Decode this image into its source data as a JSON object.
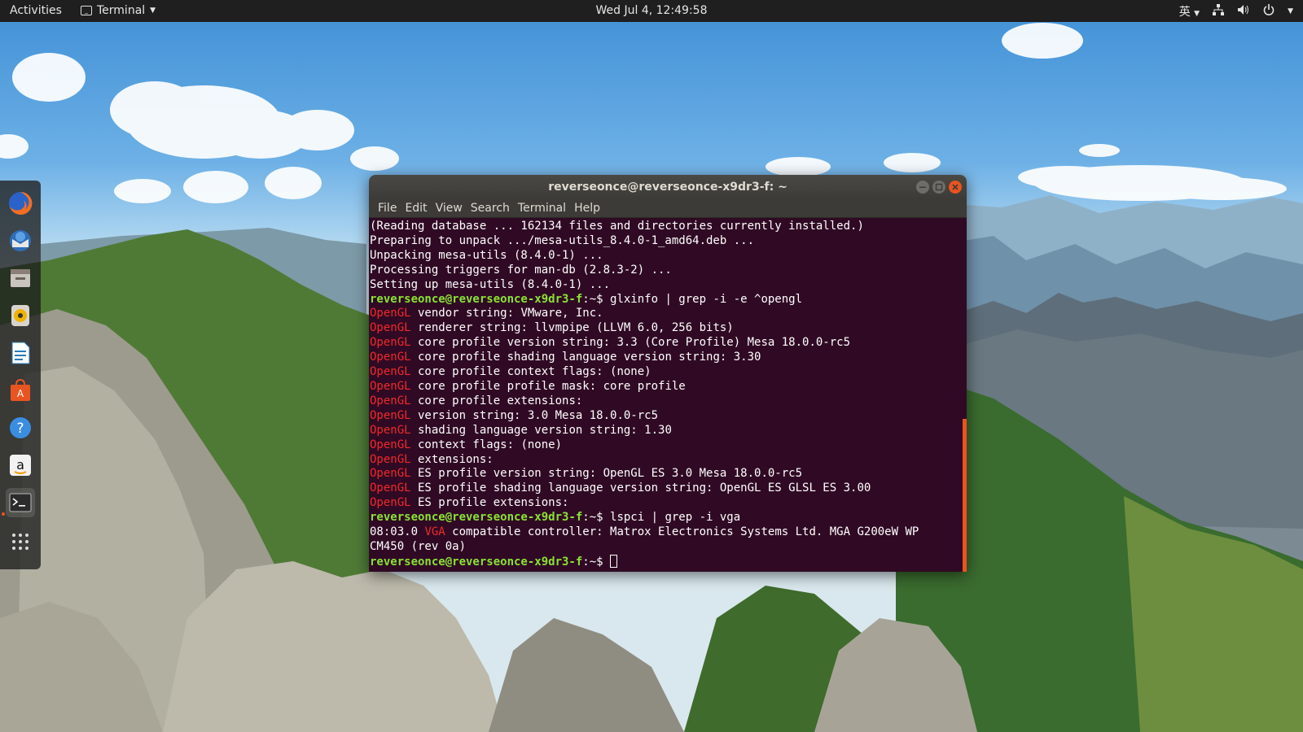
{
  "topbar": {
    "activities": "Activities",
    "app_name": "Terminal",
    "clock": "Wed Jul  4, 12:49:58",
    "input_method": "英",
    "icons": [
      "network-icon",
      "volume-icon",
      "power-icon"
    ]
  },
  "dock": {
    "items": [
      "firefox-icon",
      "thunderbird-icon",
      "files-icon",
      "rhythmbox-icon",
      "libreoffice-writer-icon",
      "software-center-icon",
      "help-icon",
      "amazon-icon",
      "terminal-icon",
      "show-apps-icon"
    ]
  },
  "window": {
    "title": "reverseonce@reverseonce-x9dr3-f: ~",
    "menu": [
      "File",
      "Edit",
      "View",
      "Search",
      "Terminal",
      "Help"
    ],
    "prompt": "reverseonce@reverseonce-x9dr3-f",
    "prompt_suffix": ":~$ ",
    "lines": [
      {
        "text": "(Reading database ... 162134 files and directories currently installed.)"
      },
      {
        "text": "Preparing to unpack .../mesa-utils_8.4.0-1_amd64.deb ..."
      },
      {
        "text": "Unpacking mesa-utils (8.4.0-1) ..."
      },
      {
        "text": "Processing triggers for man-db (2.8.3-2) ..."
      },
      {
        "text": "Setting up mesa-utils (8.4.0-1) ..."
      },
      {
        "cmd": "glxinfo | grep -i -e ^opengl"
      },
      {
        "hl": "OpenGL",
        "text": " vendor string: VMware, Inc."
      },
      {
        "hl": "OpenGL",
        "text": " renderer string: llvmpipe (LLVM 6.0, 256 bits)"
      },
      {
        "hl": "OpenGL",
        "text": " core profile version string: 3.3 (Core Profile) Mesa 18.0.0-rc5"
      },
      {
        "hl": "OpenGL",
        "text": " core profile shading language version string: 3.30"
      },
      {
        "hl": "OpenGL",
        "text": " core profile context flags: (none)"
      },
      {
        "hl": "OpenGL",
        "text": " core profile profile mask: core profile"
      },
      {
        "hl": "OpenGL",
        "text": " core profile extensions:"
      },
      {
        "hl": "OpenGL",
        "text": " version string: 3.0 Mesa 18.0.0-rc5"
      },
      {
        "hl": "OpenGL",
        "text": " shading language version string: 1.30"
      },
      {
        "hl": "OpenGL",
        "text": " context flags: (none)"
      },
      {
        "hl": "OpenGL",
        "text": " extensions:"
      },
      {
        "hl": "OpenGL",
        "text": " ES profile version string: OpenGL ES 3.0 Mesa 18.0.0-rc5"
      },
      {
        "hl": "OpenGL",
        "text": " ES profile shading language version string: OpenGL ES GLSL ES 3.00"
      },
      {
        "hl": "OpenGL",
        "text": " ES profile extensions:"
      },
      {
        "cmd": "lspci | grep -i vga"
      },
      {
        "pre": "08:03.0 ",
        "hl": "VGA",
        "text": " compatible controller: Matrox Electronics Systems Ltd. MGA G200eW WP"
      },
      {
        "text": "CM450 (rev 0a)"
      },
      {
        "cmd": "",
        "cursor": true
      }
    ]
  },
  "colors": {
    "terminal_bg": "#300a24",
    "prompt": "#8ae234",
    "highlight": "#ef2929",
    "close_button": "#e95420",
    "scrollbar": "#e95420"
  }
}
